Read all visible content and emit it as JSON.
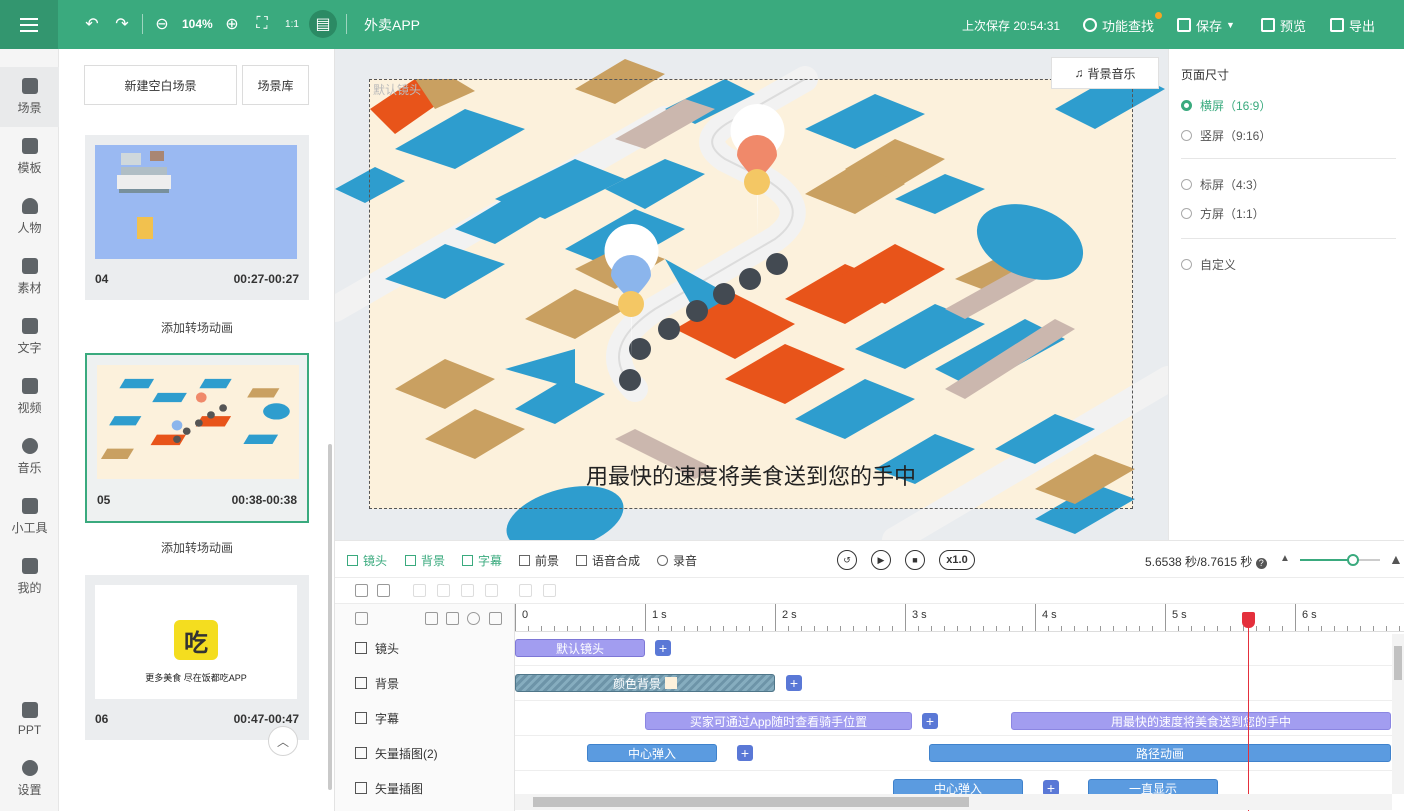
{
  "topbar": {
    "menu_icon": "hamburger-icon",
    "zoom": "104%",
    "project_name": "外卖APP",
    "last_saved": "上次保存 20:54:31",
    "find_label": "功能查找",
    "save_label": "保存",
    "preview_label": "预览",
    "export_label": "导出",
    "accent_color": "#3aaa7e"
  },
  "rail": {
    "items": [
      {
        "label": "场景",
        "icon": "scene-icon"
      },
      {
        "label": "模板",
        "icon": "template-icon"
      },
      {
        "label": "人物",
        "icon": "person-icon"
      },
      {
        "label": "素材",
        "icon": "material-icon"
      },
      {
        "label": "文字",
        "icon": "text-icon"
      },
      {
        "label": "视频",
        "icon": "video-icon"
      },
      {
        "label": "音乐",
        "icon": "music-icon"
      },
      {
        "label": "小工具",
        "icon": "toolbox-icon"
      },
      {
        "label": "我的",
        "icon": "upload-icon"
      },
      {
        "label": "PPT",
        "icon": "ppt-icon"
      },
      {
        "label": "设置",
        "icon": "gear-icon"
      }
    ]
  },
  "scenes": {
    "new_blank": "新建空白场景",
    "library": "场景库",
    "transition_label": "添加转场动画",
    "cards": [
      {
        "num": "04",
        "time": "00:27-00:27"
      },
      {
        "num": "05",
        "time": "00:38-00:38"
      },
      {
        "num": "06",
        "time": "00:47-00:47",
        "logo_char": "吃",
        "tagline": "更多美食 尽在饭都吃APP"
      }
    ]
  },
  "canvas": {
    "camera_label": "默认镜头",
    "bgm_label": "背景音乐",
    "caption": "用最快的速度将美食送到您的手中"
  },
  "page_size": {
    "title": "页面尺寸",
    "options": [
      "横屏（16:9）",
      "竖屏（9:16）",
      "标屏（4:3）",
      "方屏（1:1）",
      "自定义"
    ],
    "selected": "横屏（16:9）"
  },
  "timeline_toolbar": {
    "tabs": [
      "镜头",
      "背景",
      "字幕",
      "前景",
      "语音合成",
      "录音"
    ],
    "speed": "x1.0",
    "time": "5.6538 秒/8.7615 秒",
    "zoom_level": 0.66
  },
  "timeline": {
    "ruler": [
      "0",
      "1 s",
      "2 s",
      "3 s",
      "4 s",
      "5 s",
      "6 s"
    ],
    "tracks": [
      "镜头",
      "背景",
      "字幕",
      "矢量插图(2)",
      "矢量插图"
    ],
    "clips": {
      "camera": "默认镜头",
      "background": "颜色背景",
      "subtitle_1": "买家可通过App随时查看骑手位置",
      "subtitle_2": "用最快的速度将美食送到您的手中",
      "vec2_a": "中心弹入",
      "vec2_b": "路径动画",
      "vec_a": "中心弹入",
      "vec_b": "一直显示"
    },
    "playhead_seconds": 5.6538
  }
}
